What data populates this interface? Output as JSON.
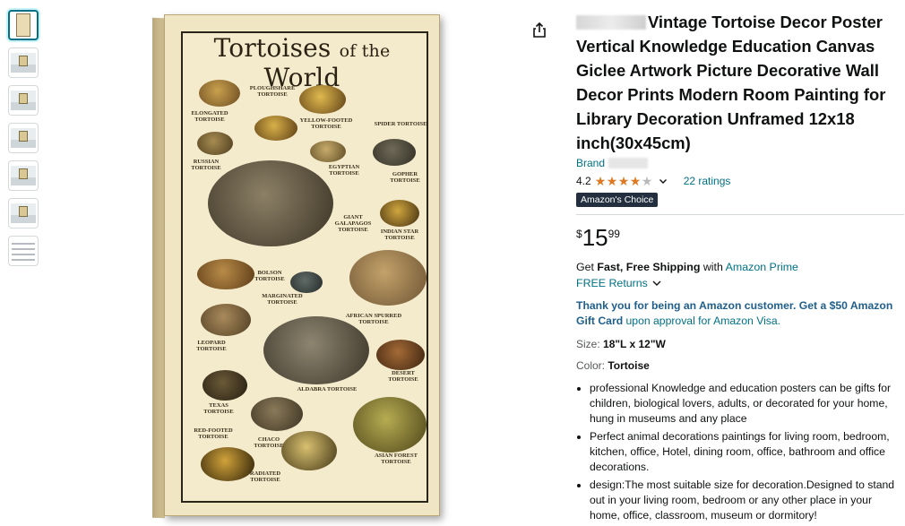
{
  "product": {
    "title": "Vintage Tortoise Decor Poster Vertical Knowledge Education Canvas Giclee Artwork Picture Decorative Wall Decor Prints Modern Room Painting for Library Decoration Unframed 12x18 inch(30x45cm)",
    "brand_label": "Brand",
    "rating_value": "4.2",
    "ratings_count": "22 ratings",
    "badge": "Amazon's Choice",
    "price": {
      "symbol": "$",
      "whole": "15",
      "fraction": "99"
    },
    "shipping": {
      "prefix": "Get ",
      "bold": "Fast, Free Shipping",
      "mid": " with ",
      "link": "Amazon Prime"
    },
    "returns": "FREE Returns",
    "promo": {
      "bold": "Thank you for being an Amazon customer. Get a $50 Amazon Gift Card",
      "rest": " upon approval for Amazon Visa."
    },
    "size": {
      "label": "Size: ",
      "value": "18\"L x 12\"W"
    },
    "color": {
      "label": "Color: ",
      "value": "Tortoise"
    },
    "bullets": [
      "professional Knowledge and education posters can be gifts for children, biological lovers, adults, or decorated for your home, hung in museums and any place",
      "Perfect animal decorations paintings for living room, bedroom, kitchen, office, Hotel, dining room, office, bathroom and office decorations.",
      "design:The most suitable size for decoration.Designed to stand out in your living room, bedroom or any other place in your home, office, classroom, museum or dormitory!"
    ]
  },
  "poster": {
    "title_main1": "Tortoises",
    "title_small": "of the",
    "title_main2": "World",
    "labels": {
      "ploughshare": "Ploughshare Tortoise",
      "elongated": "Elongated Tortoise",
      "yellow_footed": "Yellow-Footed Tortoise",
      "spider": "Spider Tortoise",
      "russian": "Russian Tortoise",
      "egyptian": "Egyptian Tortoise",
      "gopher": "Gopher Tortoise",
      "giant": "Giant Galapagos Tortoise",
      "indian_star": "Indian Star Tortoise",
      "bolson": "Bolson Tortoise",
      "marginated": "Marginated Tortoise",
      "african_spurred": "African Spurred Tortoise",
      "leopard": "Leopard Tortoise",
      "desert": "Desert Tortoise",
      "texas": "Texas Tortoise",
      "aldabra": "Aldabra Tortoise",
      "red_footed": "Red-Footed Tortoise",
      "chaco": "Chaco Tortoise",
      "radiated": "Radiated Tortoise",
      "asian_forest": "Asian Forest Tortoise"
    }
  },
  "colors": {
    "link": "#007185",
    "star": "#de7921",
    "badge_bg": "#232f3e"
  },
  "icons": {
    "share": "share-icon",
    "chevron": "chevron-down-icon"
  }
}
